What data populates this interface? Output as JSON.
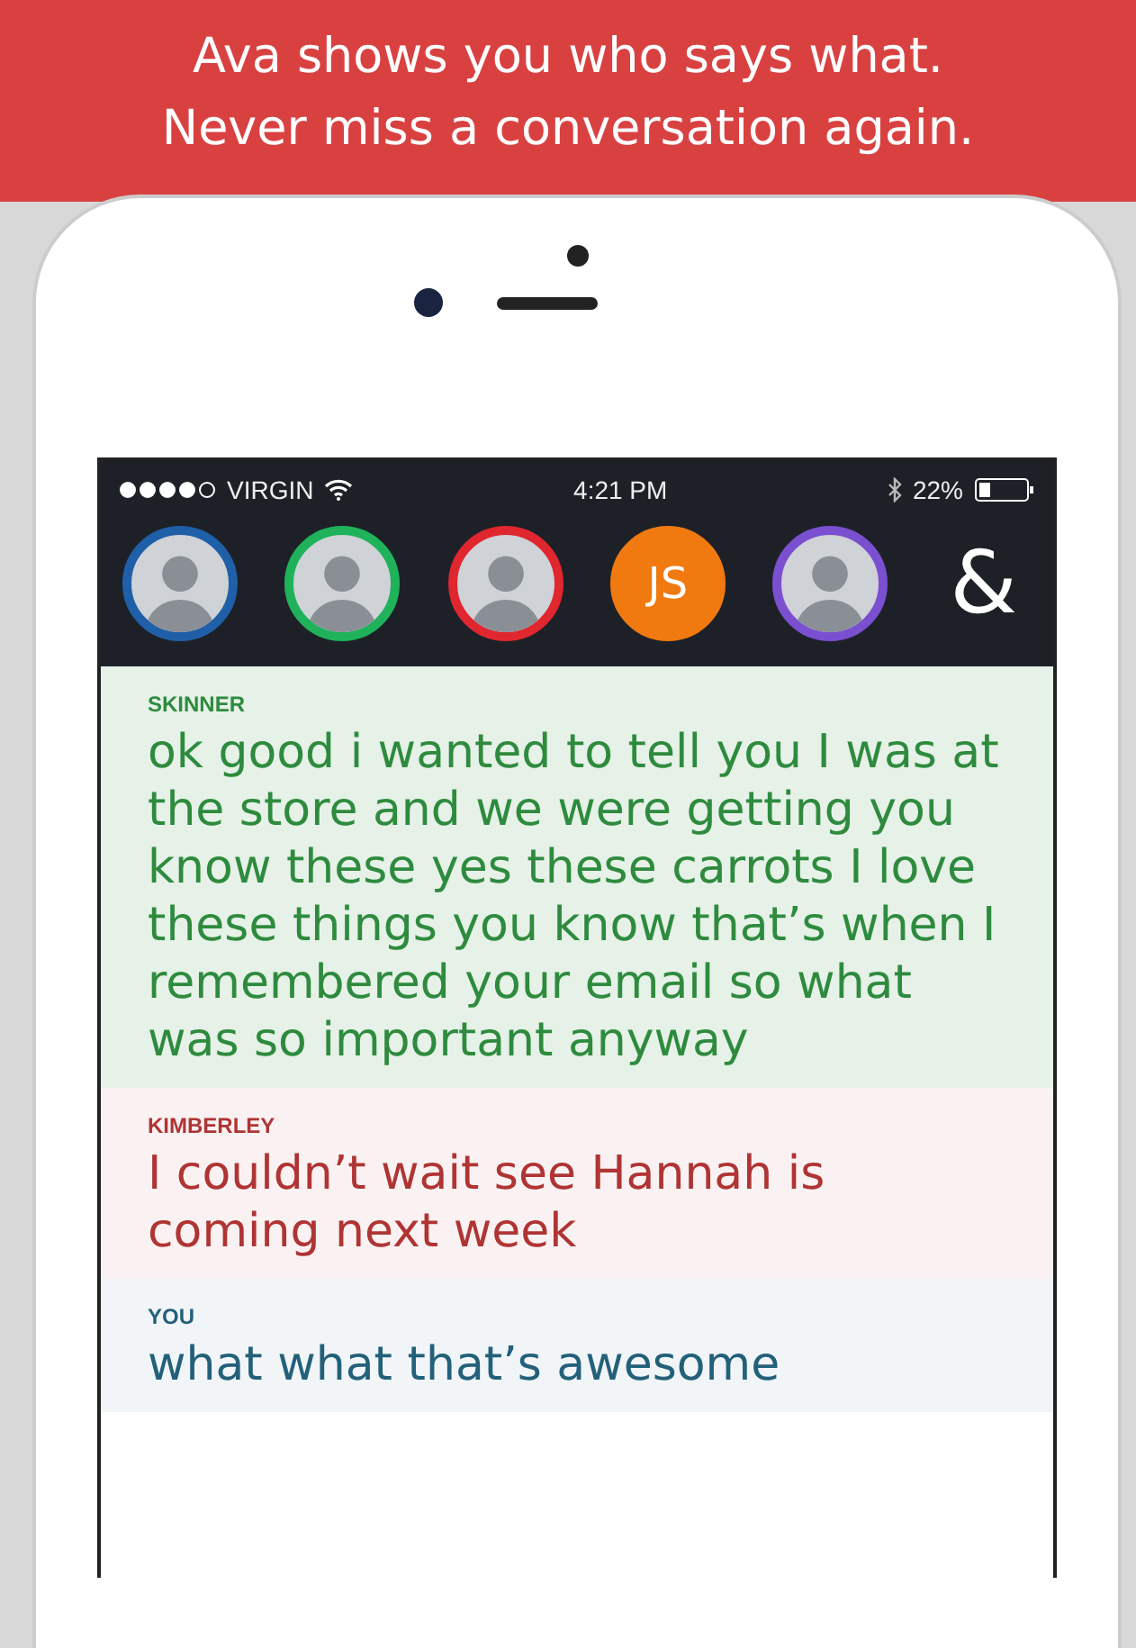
{
  "headline": [
    "Ava shows you who says what.",
    "Never miss a conversation again."
  ],
  "status_bar": {
    "carrier": "VIRGIN",
    "time": "4:21 PM",
    "battery": "22%"
  },
  "participants": [
    {
      "kind": "photo",
      "color": "#1f5fa8"
    },
    {
      "kind": "photo",
      "color": "#1fb25a"
    },
    {
      "kind": "photo",
      "color": "#e0262e"
    },
    {
      "kind": "initials",
      "color": "#f07a10",
      "initials": "JS"
    },
    {
      "kind": "photo",
      "color": "#7a4fd0"
    }
  ],
  "add_symbol": "&",
  "messages": [
    {
      "speaker": "SKINNER",
      "color": "#2e8b3e",
      "text": "ok good i wanted to tell you I was at the store and we were getting you know these yes these carrots I love these things you know that’s when I remembered your email so what was so important anyway"
    },
    {
      "speaker": "KIMBERLEY",
      "color": "#b03434",
      "text": "I couldn’t wait see Hannah is coming next week"
    },
    {
      "speaker": "YOU",
      "color": "#23607a",
      "text": "what what that’s awesome"
    }
  ]
}
